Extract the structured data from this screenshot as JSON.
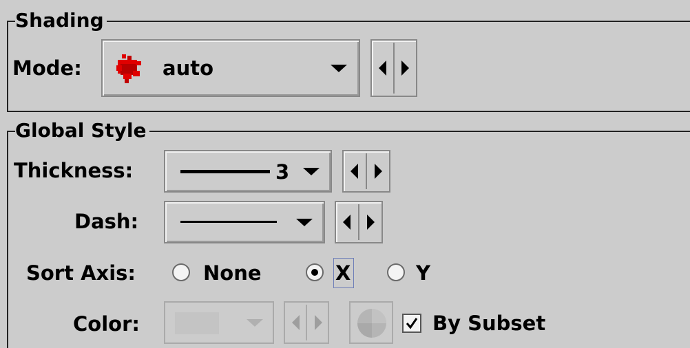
{
  "shading": {
    "title": "Shading",
    "mode_label": "Mode:",
    "mode_value": "auto",
    "mode_icon": "red-blob-icon"
  },
  "global_style": {
    "title": "Global Style",
    "thickness_label": "Thickness:",
    "thickness_value": "3",
    "dash_label": "Dash:",
    "sort_axis_label": "Sort Axis:",
    "sort_axis_options": [
      "None",
      "X",
      "Y"
    ],
    "sort_axis_selected": "X",
    "color_label": "Color:",
    "color_enabled": false,
    "by_subset_label": "By Subset",
    "by_subset_checked": true
  },
  "colors": {
    "background": "#cccccc",
    "mode_icon": "#e00000",
    "disabled": "#9e9e9e"
  }
}
